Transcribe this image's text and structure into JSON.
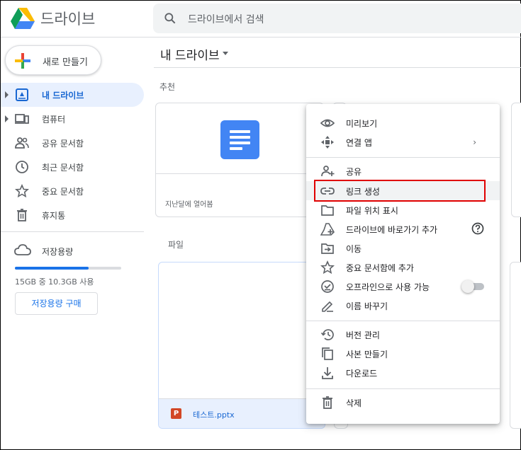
{
  "app": {
    "title": "드라이브"
  },
  "search": {
    "placeholder": "드라이브에서 검색"
  },
  "sidebar": {
    "new_button": "새로 만들기",
    "items": [
      {
        "label": "내 드라이브",
        "icon": "my-drive-icon",
        "active": true
      },
      {
        "label": "컴퓨터",
        "icon": "computer-icon"
      },
      {
        "label": "공유 문서함",
        "icon": "shared-icon"
      },
      {
        "label": "최근 문서함",
        "icon": "recent-icon"
      },
      {
        "label": "중요 문서함",
        "icon": "star-icon"
      },
      {
        "label": "휴지통",
        "icon": "trash-icon"
      }
    ],
    "storage": {
      "label": "저장용량",
      "usage_text": "15GB 중 10.3GB 사용",
      "used_fraction": 0.69,
      "buy_button": "저장용량 구매"
    }
  },
  "main": {
    "title": "내 드라이브",
    "recommended_label": "추천",
    "recommended_card_subtitle": "지난달에 열어봄",
    "files_label": "파일",
    "file": {
      "name": "테스트.pptx",
      "type_badge": "P"
    }
  },
  "context_menu": {
    "items": [
      {
        "label": "미리보기",
        "icon": "eye-icon"
      },
      {
        "label": "연결 앱",
        "icon": "open-with-icon",
        "submenu": "›"
      },
      {
        "label": "공유",
        "icon": "share-icon"
      },
      {
        "label": "링크 생성",
        "icon": "link-icon",
        "hovered": true
      },
      {
        "label": "파일 위치 표시",
        "icon": "folder-icon"
      },
      {
        "label": "드라이브에 바로가기 추가",
        "icon": "add-shortcut-icon"
      },
      {
        "label": "이동",
        "icon": "move-icon"
      },
      {
        "label": "중요 문서함에 추가",
        "icon": "star-icon"
      },
      {
        "label": "오프라인으로 사용 가능",
        "icon": "offline-icon",
        "toggle": false
      },
      {
        "label": "이름 바꾸기",
        "icon": "rename-icon"
      },
      {
        "label": "버전 관리",
        "icon": "version-icon"
      },
      {
        "label": "사본 만들기",
        "icon": "copy-icon"
      },
      {
        "label": "다운로드",
        "icon": "download-icon"
      },
      {
        "label": "삭제",
        "icon": "trash-icon"
      }
    ]
  },
  "colors": {
    "accent": "#1a73e8",
    "active_bg": "#e8f0fe",
    "highlight_box": "#e00000"
  }
}
